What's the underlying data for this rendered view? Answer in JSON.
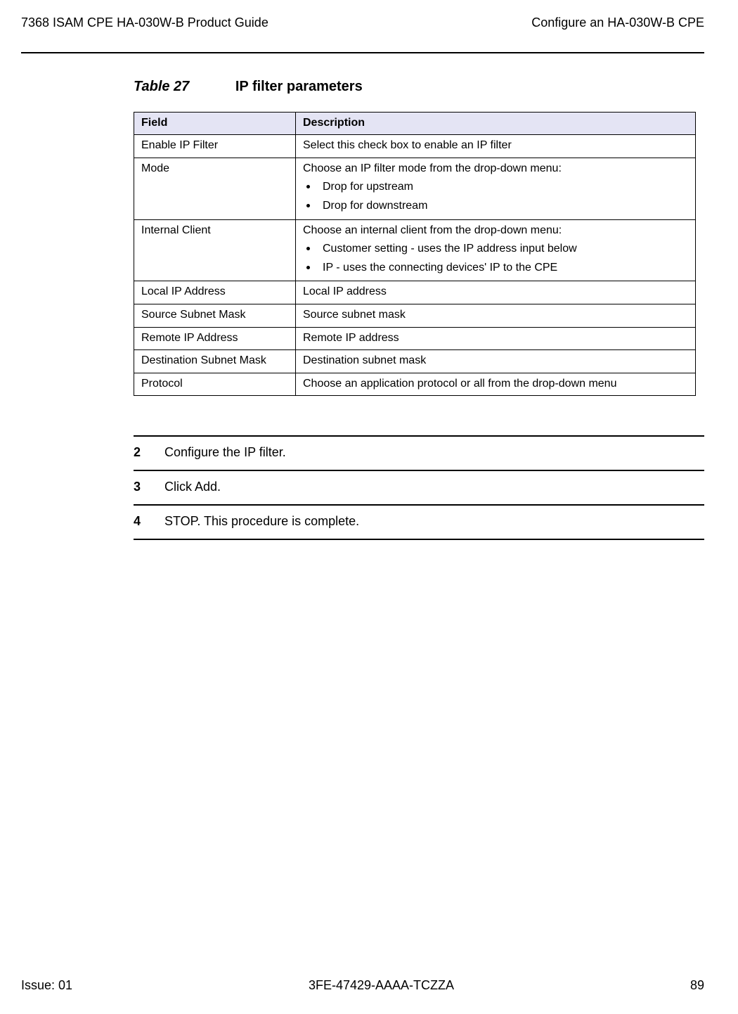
{
  "header": {
    "left": "7368 ISAM CPE HA-030W-B Product Guide",
    "right": "Configure an HA-030W-B CPE"
  },
  "table": {
    "number": "Table 27",
    "title": "IP filter parameters",
    "col_field": "Field",
    "col_desc": "Description",
    "rows": {
      "r0": {
        "field": "Enable IP Filter",
        "desc": "Select this check box to enable an IP filter"
      },
      "r1": {
        "field": "Mode",
        "desc_intro": "Choose an IP filter mode from the drop-down menu:",
        "b1": "Drop for upstream",
        "b2": "Drop for downstream"
      },
      "r2": {
        "field": "Internal Client",
        "desc_intro": "Choose an internal client from the drop-down menu:",
        "b1": "Customer setting - uses the IP address input below",
        "b2": "IP - uses the connecting devices' IP to the CPE"
      },
      "r3": {
        "field": "Local IP Address",
        "desc": "Local IP address"
      },
      "r4": {
        "field": "Source Subnet Mask",
        "desc": "Source subnet mask"
      },
      "r5": {
        "field": "Remote IP Address",
        "desc": "Remote IP address"
      },
      "r6": {
        "field": "Destination Subnet Mask",
        "desc": "Destination subnet mask"
      },
      "r7": {
        "field": "Protocol",
        "desc": "Choose an application protocol or all from the drop-down menu"
      }
    }
  },
  "steps": {
    "s2": {
      "num": "2",
      "text": "Configure the IP filter."
    },
    "s3": {
      "num": "3",
      "text": "Click Add."
    },
    "s4": {
      "num": "4",
      "text": "STOP. This procedure is complete."
    }
  },
  "footer": {
    "left": "Issue: 01",
    "center": "3FE-47429-AAAA-TCZZA",
    "right": "89"
  }
}
